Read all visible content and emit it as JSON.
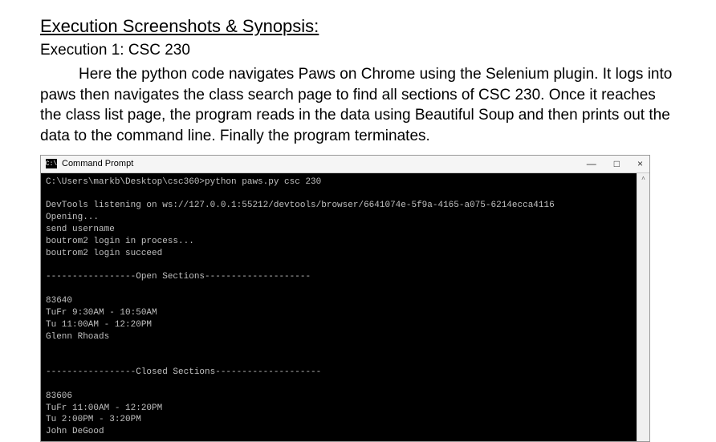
{
  "doc": {
    "heading": "Execution Screenshots & Synopsis:",
    "subheading": "Execution 1: CSC 230",
    "paragraph": "Here the python code navigates Paws on Chrome using the Selenium plugin. It logs into paws then navigates the class search page to find all sections of CSC 230. Once it reaches the class list page, the program reads in the data using Beautiful Soup and then prints out the data to the command line. Finally the program terminates."
  },
  "window": {
    "title": "Command Prompt",
    "icon_label": "C:\\",
    "controls": {
      "minimize": "—",
      "maximize": "□",
      "close": "×"
    },
    "scrollbar_up": "˄"
  },
  "terminal": {
    "lines": [
      "C:\\Users\\markb\\Desktop\\csc360>python paws.py csc 230",
      "",
      "DevTools listening on ws://127.0.0.1:55212/devtools/browser/6641074e-5f9a-4165-a075-6214ecca4116",
      "Opening...",
      "send username",
      "boutrom2 login in process...",
      "boutrom2 login succeed",
      "",
      "-----------------Open Sections--------------------",
      "",
      "83640",
      "TuFr 9:30AM - 10:50AM",
      "Tu 11:00AM - 12:20PM",
      "Glenn Rhoads",
      "",
      "",
      "-----------------Closed Sections--------------------",
      "",
      "83606",
      "TuFr 11:00AM - 12:20PM",
      "Tu 2:00PM - 3:20PM",
      "John DeGood"
    ]
  }
}
